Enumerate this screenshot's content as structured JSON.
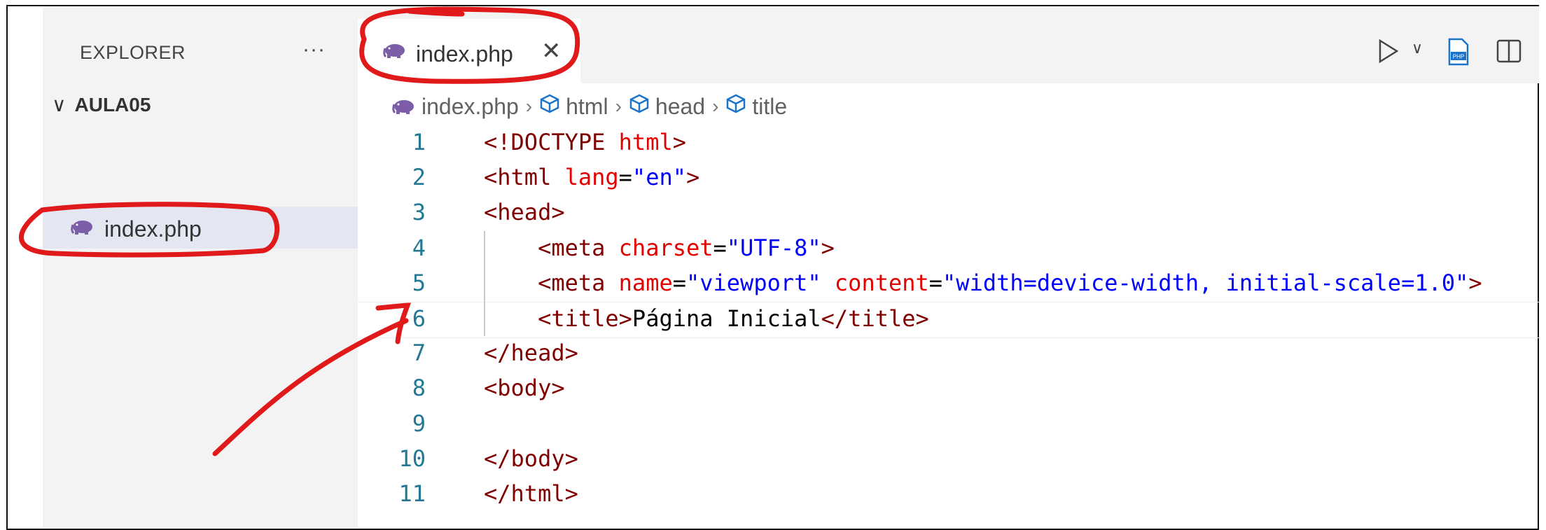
{
  "explorer": {
    "title": "EXPLORER",
    "more": "···",
    "folder": "AULA05",
    "folder_chevron": "∨",
    "file": "index.php"
  },
  "tab": {
    "label": "index.php",
    "close": "✕"
  },
  "breadcrumb": {
    "file": "index.php",
    "items": [
      "html",
      "head",
      "title"
    ],
    "separator": "›"
  },
  "toolbar": {
    "run_icon": "play-icon",
    "run_chevron": "∨"
  },
  "editor": {
    "lines": [
      {
        "n": "1",
        "parts": [
          [
            "tg",
            "<!DOCTYPE "
          ],
          [
            "at",
            "html"
          ],
          [
            "tg",
            ">"
          ]
        ]
      },
      {
        "n": "2",
        "parts": [
          [
            "tg",
            "<html "
          ],
          [
            "at",
            "lang"
          ],
          [
            "tx",
            "="
          ],
          [
            "vl",
            "\"en\""
          ],
          [
            "tg",
            ">"
          ]
        ]
      },
      {
        "n": "3",
        "parts": [
          [
            "tg",
            "<head>"
          ]
        ]
      },
      {
        "n": "4",
        "parts": [
          [
            "tx",
            "    "
          ],
          [
            "tg",
            "<meta "
          ],
          [
            "at",
            "charset"
          ],
          [
            "tx",
            "="
          ],
          [
            "vl",
            "\"UTF-8\""
          ],
          [
            "tg",
            ">"
          ]
        ]
      },
      {
        "n": "5",
        "parts": [
          [
            "tx",
            "    "
          ],
          [
            "tg",
            "<meta "
          ],
          [
            "at",
            "name"
          ],
          [
            "tx",
            "="
          ],
          [
            "vl",
            "\"viewport\""
          ],
          [
            "tx",
            " "
          ],
          [
            "at",
            "content"
          ],
          [
            "tx",
            "="
          ],
          [
            "vl",
            "\"width=device-width, initial-scale=1.0\""
          ],
          [
            "tg",
            ">"
          ]
        ]
      },
      {
        "n": "6",
        "parts": [
          [
            "tx",
            "    "
          ],
          [
            "tg",
            "<title>"
          ],
          [
            "tx",
            "Página Inicial"
          ],
          [
            "tg",
            "</title>"
          ]
        ]
      },
      {
        "n": "7",
        "parts": [
          [
            "tg",
            "</head>"
          ]
        ]
      },
      {
        "n": "8",
        "parts": [
          [
            "tg",
            "<body>"
          ]
        ]
      },
      {
        "n": "9",
        "parts": []
      },
      {
        "n": "10",
        "parts": [
          [
            "tg",
            "</body>"
          ]
        ]
      },
      {
        "n": "11",
        "parts": [
          [
            "tg",
            "</html>"
          ]
        ]
      }
    ],
    "current_line": 6
  },
  "colors": {
    "tag": "#800000",
    "attr": "#e50000",
    "value": "#0000ff",
    "linenum": "#237893",
    "annotation": "#e0191a",
    "php_icon": "#7b5ea7"
  }
}
